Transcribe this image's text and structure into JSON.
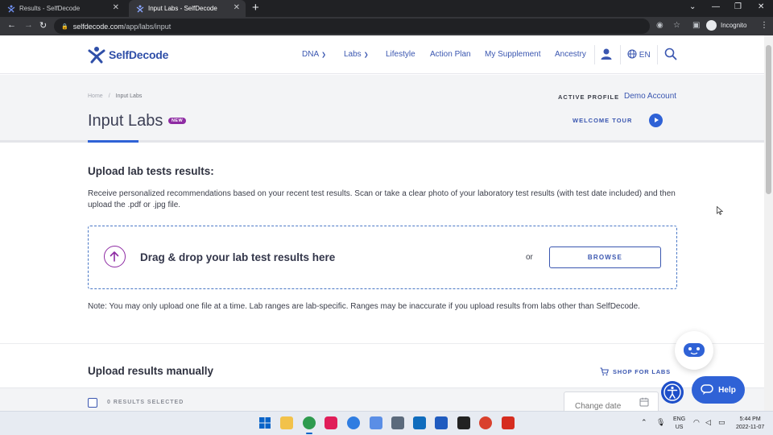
{
  "browser": {
    "tabs": [
      {
        "title": "Results - SelfDecode"
      },
      {
        "title": "Input Labs - SelfDecode"
      }
    ],
    "url_host": "selfdecode.com",
    "url_path": "/app/labs/input",
    "profile_label": "Incognito"
  },
  "header": {
    "brand": "SelfDecode",
    "nav": [
      "DNA",
      "Labs",
      "Lifestyle",
      "Action Plan",
      "My Supplement",
      "Ancestry"
    ],
    "language": "EN"
  },
  "page": {
    "breadcrumb": [
      "Home",
      "Input Labs"
    ],
    "title": "Input Labs",
    "badge": "NEW",
    "active_profile_label": "ACTIVE PROFILE",
    "active_profile_name": "Demo Account",
    "welcome_tour": "WELCOME TOUR"
  },
  "upload": {
    "title": "Upload lab tests results:",
    "description": "Receive personalized recommendations based on your recent test results. Scan or take a clear photo of your laboratory test results (with test date included) and then upload the .pdf or .jpg file.",
    "drop_text": "Drag & drop your lab test results here",
    "or": "or",
    "browse": "BROWSE",
    "note": "Note: You may only upload one file at a time. Lab ranges are lab-specific. Ranges may be inaccurate if you upload results from labs other than SelfDecode."
  },
  "manual": {
    "title": "Upload results manually",
    "shop": "SHOP FOR LABS",
    "selected": "0 RESULTS SELECTED",
    "date_placeholder": "Change date"
  },
  "widgets": {
    "help": "Help"
  },
  "taskbar": {
    "lang_top": "ENG",
    "lang_bottom": "US",
    "time": "5:44 PM",
    "date": "2022-11-07"
  },
  "colors": {
    "brand_blue": "#3a56b0",
    "accent_blue": "#2f62d6",
    "badge_purple": "#8e2ba3"
  }
}
